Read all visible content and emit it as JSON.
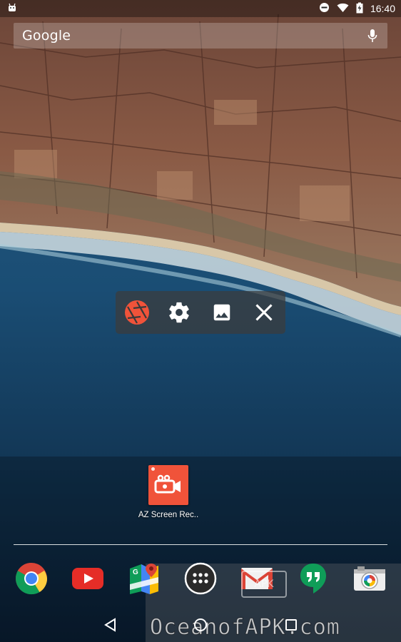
{
  "status_bar": {
    "time": "16:40",
    "left_icon": "android-debug-icon",
    "right_icons": [
      "do-not-disturb-icon",
      "wifi-icon",
      "battery-charging-icon"
    ]
  },
  "search": {
    "brand": "Google",
    "mic_icon": "mic-icon"
  },
  "floating_toolbar": {
    "buttons": [
      {
        "name": "record-shutter-icon",
        "color": "#f0533a"
      },
      {
        "name": "settings-icon"
      },
      {
        "name": "gallery-icon"
      },
      {
        "name": "close-icon"
      }
    ]
  },
  "shortcut": {
    "label": "AZ Screen Rec..",
    "icon": "video-camera-icon",
    "color": "#f0533a"
  },
  "dock": {
    "apps": [
      "chrome-icon",
      "youtube-icon",
      "maps-icon",
      "app-drawer-icon",
      "gmail-icon",
      "hangouts-icon",
      "camera-icon"
    ]
  },
  "nav": {
    "buttons": [
      "back-icon",
      "home-icon",
      "recents-icon"
    ]
  },
  "watermark": {
    "text": "OceanofAPK.com",
    "logo": "APK"
  }
}
